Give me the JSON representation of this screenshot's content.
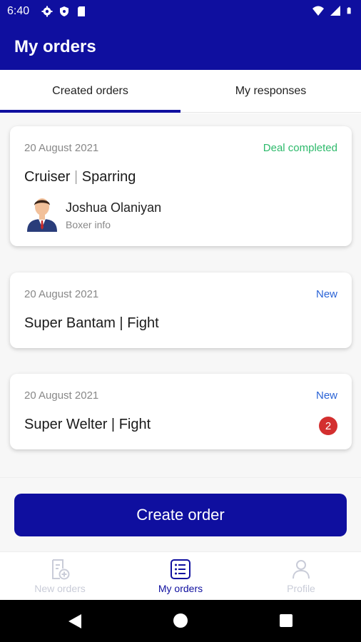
{
  "status_bar": {
    "time": "6:40",
    "left_icons": [
      "gear-icon",
      "shield-icon",
      "sim-card-icon"
    ],
    "right_icons": [
      "wifi-icon",
      "signal-icon",
      "battery-icon"
    ]
  },
  "app_bar": {
    "title": "My orders"
  },
  "tabs": [
    {
      "label": "Created orders",
      "selected": true
    },
    {
      "label": "My responses",
      "selected": false
    }
  ],
  "orders": [
    {
      "date": "20 August 2021",
      "status": "Deal completed",
      "weight_class": "Cruiser",
      "separator": "|",
      "type": "Sparring",
      "boxer": {
        "name": "Joshua Olaniyan",
        "subtitle": "Boxer info"
      }
    },
    {
      "date": "20 August 2021",
      "status": "New",
      "weight_class": "Super Bantam",
      "separator": "|",
      "type": "Fight"
    },
    {
      "date": "20 August 2021",
      "status": "New",
      "weight_class": "Super Welter",
      "separator": "|",
      "type": "Fight",
      "badge": "2"
    }
  ],
  "create_order_button": {
    "label": "Create order"
  },
  "bottom_nav": [
    {
      "label": "New orders",
      "icon": "new-order-icon",
      "selected": false
    },
    {
      "label": "My orders",
      "icon": "list-icon",
      "selected": true
    },
    {
      "label": "Profile",
      "icon": "profile-icon",
      "selected": false
    }
  ],
  "colors": {
    "primary": "#0f0f9f",
    "status_completed": "#2dba6b",
    "status_new": "#2a63d6",
    "badge": "#d32f2f",
    "inactive_nav": "#c9ccd8"
  }
}
